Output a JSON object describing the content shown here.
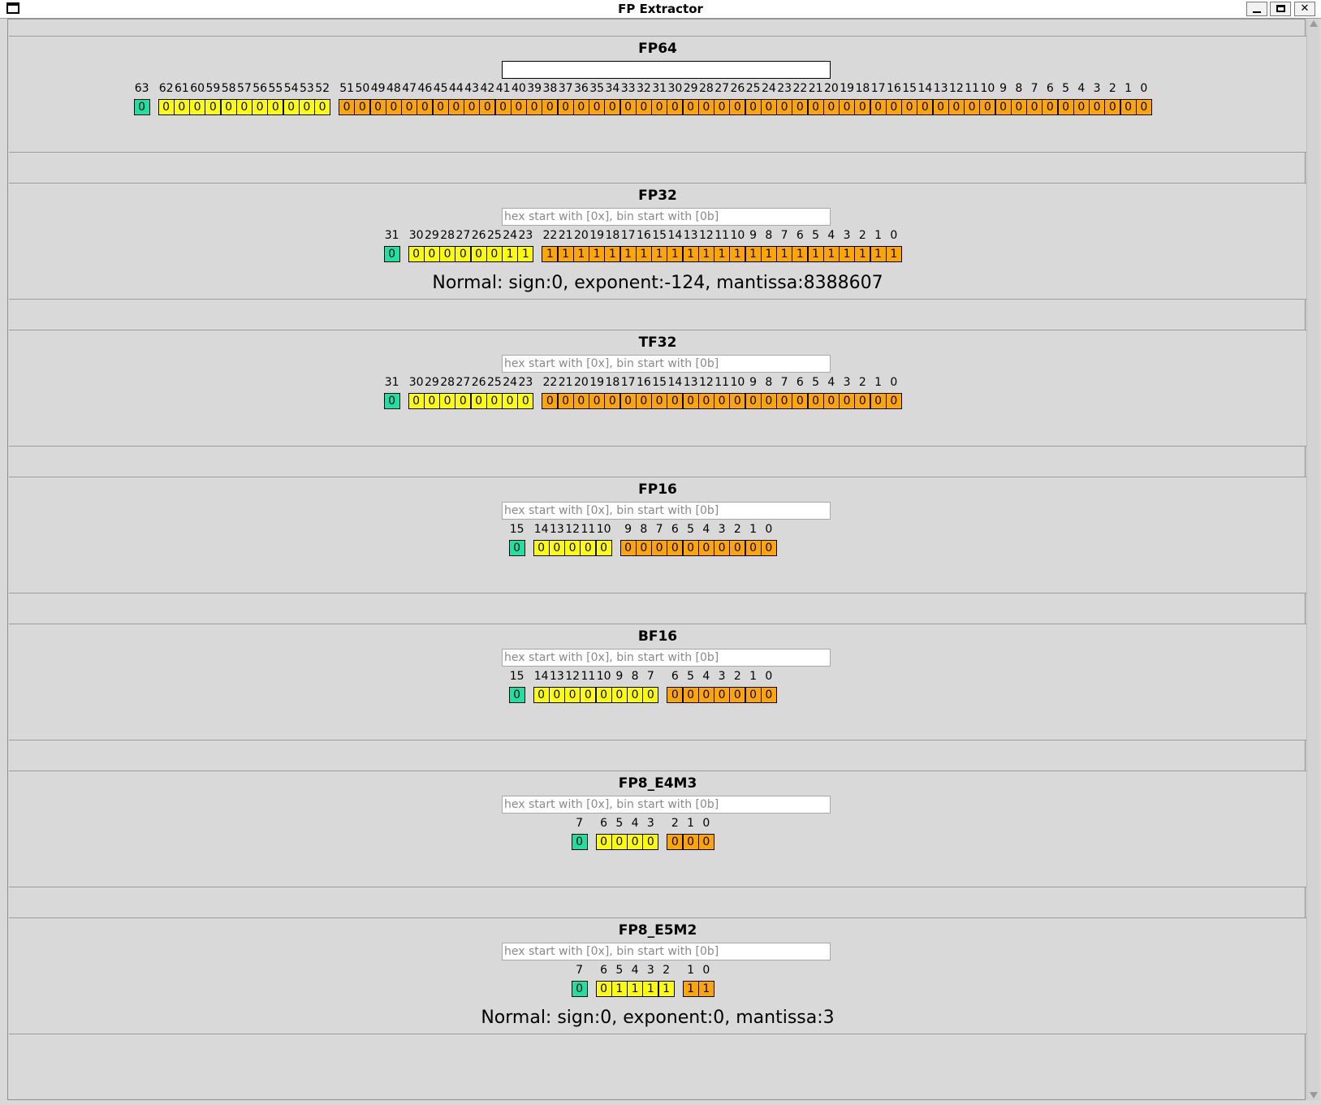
{
  "window": {
    "title": "FP Extractor",
    "minimize_label": "_",
    "close_label": "✕"
  },
  "colors": {
    "sign": "#1de1a4",
    "exponent": "#ffff00",
    "mantissa": "#ffa500"
  },
  "input_placeholder": "hex start with [0x], bin start with [0b]",
  "sections": [
    {
      "name": "FP64",
      "input_value": "",
      "placeholder": "",
      "sign_bits": [
        0
      ],
      "exponent_bits": [
        0,
        0,
        0,
        0,
        0,
        0,
        0,
        0,
        0,
        0,
        0
      ],
      "mantissa_bits": [
        0,
        0,
        0,
        0,
        0,
        0,
        0,
        0,
        0,
        0,
        0,
        0,
        0,
        0,
        0,
        0,
        0,
        0,
        0,
        0,
        0,
        0,
        0,
        0,
        0,
        0,
        0,
        0,
        0,
        0,
        0,
        0,
        0,
        0,
        0,
        0,
        0,
        0,
        0,
        0,
        0,
        0,
        0,
        0,
        0,
        0,
        0,
        0,
        0,
        0,
        0,
        0
      ],
      "result": ""
    },
    {
      "name": "FP32",
      "input_value": "",
      "placeholder": "hex start with [0x], bin start with [0b]",
      "sign_bits": [
        0
      ],
      "exponent_bits": [
        0,
        0,
        0,
        0,
        0,
        0,
        1,
        1
      ],
      "mantissa_bits": [
        1,
        1,
        1,
        1,
        1,
        1,
        1,
        1,
        1,
        1,
        1,
        1,
        1,
        1,
        1,
        1,
        1,
        1,
        1,
        1,
        1,
        1,
        1
      ],
      "result": "Normal: sign:0, exponent:-124, mantissa:8388607"
    },
    {
      "name": "TF32",
      "input_value": "",
      "placeholder": "hex start with [0x], bin start with [0b]",
      "sign_bits": [
        0
      ],
      "exponent_bits": [
        0,
        0,
        0,
        0,
        0,
        0,
        0,
        0
      ],
      "mantissa_bits": [
        0,
        0,
        0,
        0,
        0,
        0,
        0,
        0,
        0,
        0,
        0,
        0,
        0,
        0,
        0,
        0,
        0,
        0,
        0,
        0,
        0,
        0,
        0
      ],
      "result": ""
    },
    {
      "name": "FP16",
      "input_value": "",
      "placeholder": "hex start with [0x], bin start with [0b]",
      "sign_bits": [
        0
      ],
      "exponent_bits": [
        0,
        0,
        0,
        0,
        0
      ],
      "mantissa_bits": [
        0,
        0,
        0,
        0,
        0,
        0,
        0,
        0,
        0,
        0
      ],
      "result": ""
    },
    {
      "name": "BF16",
      "input_value": "",
      "placeholder": "hex start with [0x], bin start with [0b]",
      "sign_bits": [
        0
      ],
      "exponent_bits": [
        0,
        0,
        0,
        0,
        0,
        0,
        0,
        0
      ],
      "mantissa_bits": [
        0,
        0,
        0,
        0,
        0,
        0,
        0
      ],
      "result": ""
    },
    {
      "name": "FP8_E4M3",
      "input_value": "",
      "placeholder": "hex start with [0x], bin start with [0b]",
      "sign_bits": [
        0
      ],
      "exponent_bits": [
        0,
        0,
        0,
        0
      ],
      "mantissa_bits": [
        0,
        0,
        0
      ],
      "result": ""
    },
    {
      "name": "FP8_E5M2",
      "input_value": "",
      "placeholder": "hex start with [0x], bin start with [0b]",
      "sign_bits": [
        0
      ],
      "exponent_bits": [
        0,
        1,
        1,
        1,
        1
      ],
      "mantissa_bits": [
        1,
        1
      ],
      "result": "Normal: sign:0, exponent:0, mantissa:3"
    }
  ]
}
